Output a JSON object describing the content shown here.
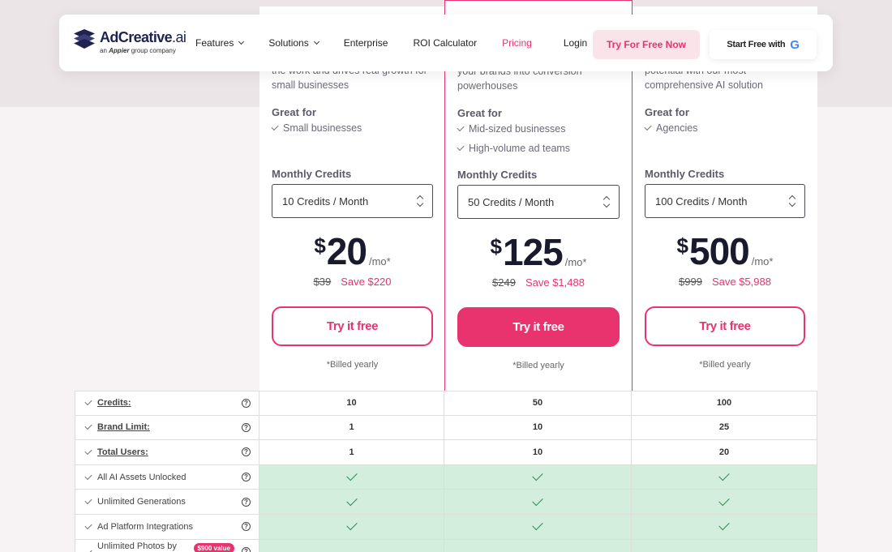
{
  "nav": {
    "logo_name": "AdCreative",
    "logo_suffix": ".ai",
    "logo_sub_prefix": "an",
    "logo_sub_brand": "Appier",
    "logo_sub_suffix": "group company",
    "items": [
      {
        "label": "Features",
        "dropdown": true
      },
      {
        "label": "Solutions",
        "dropdown": true
      },
      {
        "label": "Enterprise",
        "dropdown": false
      },
      {
        "label": "ROI Calculator",
        "dropdown": false
      },
      {
        "label": "Pricing",
        "dropdown": false,
        "active": true
      },
      {
        "label": "Login",
        "dropdown": false
      }
    ],
    "try_free_now": "Try For Free Now",
    "start_free_with": "Start Free with",
    "google_glyph": "G"
  },
  "plans": [
    {
      "desc_1": "the work and drives real growth for",
      "desc_2": "small businesses",
      "great_for_title": "Great for",
      "great_for": [
        "Small businesses"
      ],
      "credits_label": "Monthly Credits",
      "credits_value": "10 Credits / Month",
      "currency": "$",
      "price": "20",
      "unit": "/mo*",
      "old_price": "$39",
      "save": "Save $220",
      "cta": "Try it free",
      "billed": "*Billed yearly"
    },
    {
      "desc_1": "your brands into conversion",
      "desc_2": "powerhouses",
      "great_for_title": "Great for",
      "great_for": [
        "Mid-sized businesses",
        "High-volume ad teams"
      ],
      "credits_label": "Monthly Credits",
      "credits_value": "50 Credits / Month",
      "currency": "$",
      "price": "125",
      "unit": "/mo*",
      "old_price": "$249",
      "save": "Save $1,488",
      "cta": "Try it free",
      "billed": "*Billed yearly"
    },
    {
      "desc_1": "potential with our most",
      "desc_2": "comprehensive AI solution",
      "great_for_title": "Great for",
      "great_for": [
        "Agencies"
      ],
      "credits_label": "Monthly Credits",
      "credits_value": "100 Credits / Month",
      "currency": "$",
      "price": "500",
      "unit": "/mo*",
      "old_price": "$999",
      "save": "Save $5,988",
      "cta": "Try it free",
      "billed": "*Billed yearly"
    }
  ],
  "features": [
    {
      "label": "Credits:",
      "strong": true,
      "values": [
        "10",
        "50",
        "100"
      ]
    },
    {
      "label": "Brand Limit:",
      "strong": true,
      "values": [
        "1",
        "10",
        "25"
      ]
    },
    {
      "label": "Total Users:",
      "strong": true,
      "values": [
        "1",
        "10",
        "20"
      ]
    },
    {
      "label": "All AI Assets Unlocked",
      "strong": false,
      "check": true
    },
    {
      "label": "Unlimited Generations",
      "strong": false,
      "check": true
    },
    {
      "label": "Ad Platform Integrations",
      "strong": false,
      "check": true
    },
    {
      "label": "Unlimited Photos by",
      "strong": false,
      "check": true,
      "pill": "$900 value"
    }
  ],
  "help_glyph": "?",
  "colors": {
    "accent": "#e8336f",
    "check_bg": "#d4eedd",
    "brand_navy": "#1f2350"
  }
}
